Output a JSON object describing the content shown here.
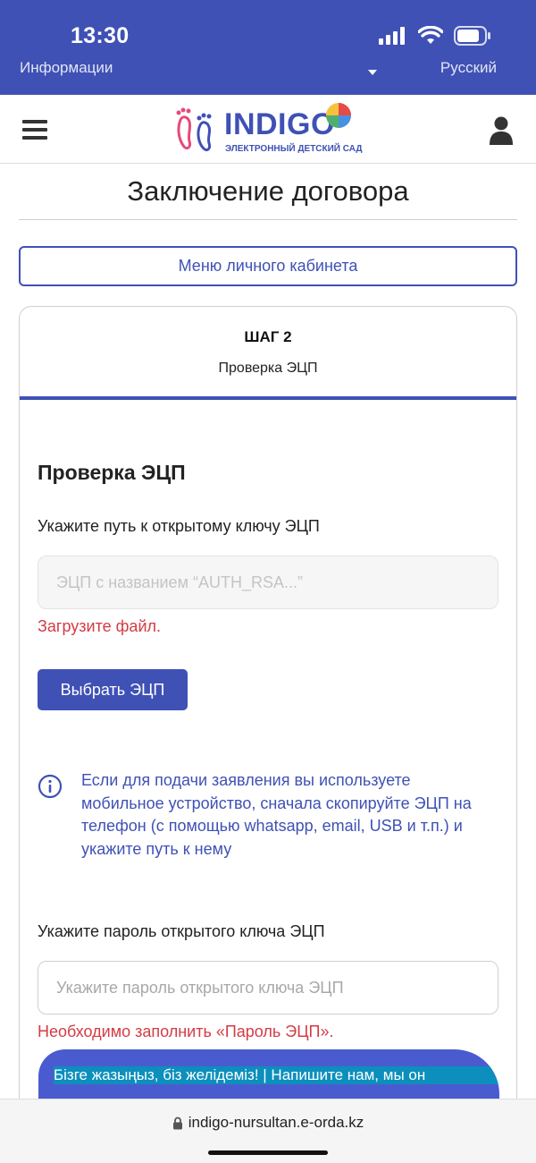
{
  "status_bar": {
    "time": "13:30",
    "icons": [
      "signal-icon",
      "wifi-icon",
      "battery-icon"
    ]
  },
  "top_strip": {
    "left_text": "Информации",
    "right_text": "Русский"
  },
  "header": {
    "logo_text": "INDIGO",
    "logo_subtitle": "ЭЛЕКТРОННЫЙ ДЕТСКИЙ САД",
    "menu_icon": "hamburger-icon",
    "user_icon": "user-icon"
  },
  "page": {
    "title": "Заключение договора",
    "cabinet_menu_label": "Меню личного кабинета"
  },
  "step": {
    "number": "ШАГ 2",
    "name": "Проверка ЭЦП"
  },
  "form": {
    "section_title": "Проверка ЭЦП",
    "key_label": "Укажите путь к открытому ключу ЭЦП",
    "key_placeholder": "ЭЦП с названием “AUTH_RSA...”",
    "key_value": "",
    "key_error": "Загрузите файл.",
    "choose_button": "Выбрать ЭЦП",
    "info_text": "Если для подачи заявления вы используете мобильное устройство, сначала скопируйте ЭЦП на телефон (с помощью whatsapp, email, USB и т.п.) и укажите путь к нему",
    "password_label": "Укажите пароль открытого ключа ЭЦП",
    "password_placeholder": "Укажите пароль открытого ключа ЭЦП",
    "password_value": "",
    "password_error": "Необходимо заполнить «Пароль ЭЦП»."
  },
  "chat_banner": {
    "text": "Бізге жазыңыз, біз желідеміз! | Напишите нам, мы он"
  },
  "browser": {
    "url": "indigo-nursultan.e-orda.kz"
  },
  "colors": {
    "primary": "#3f51b5",
    "error": "#d43b44",
    "banner_strip": "#0c8fbd"
  }
}
